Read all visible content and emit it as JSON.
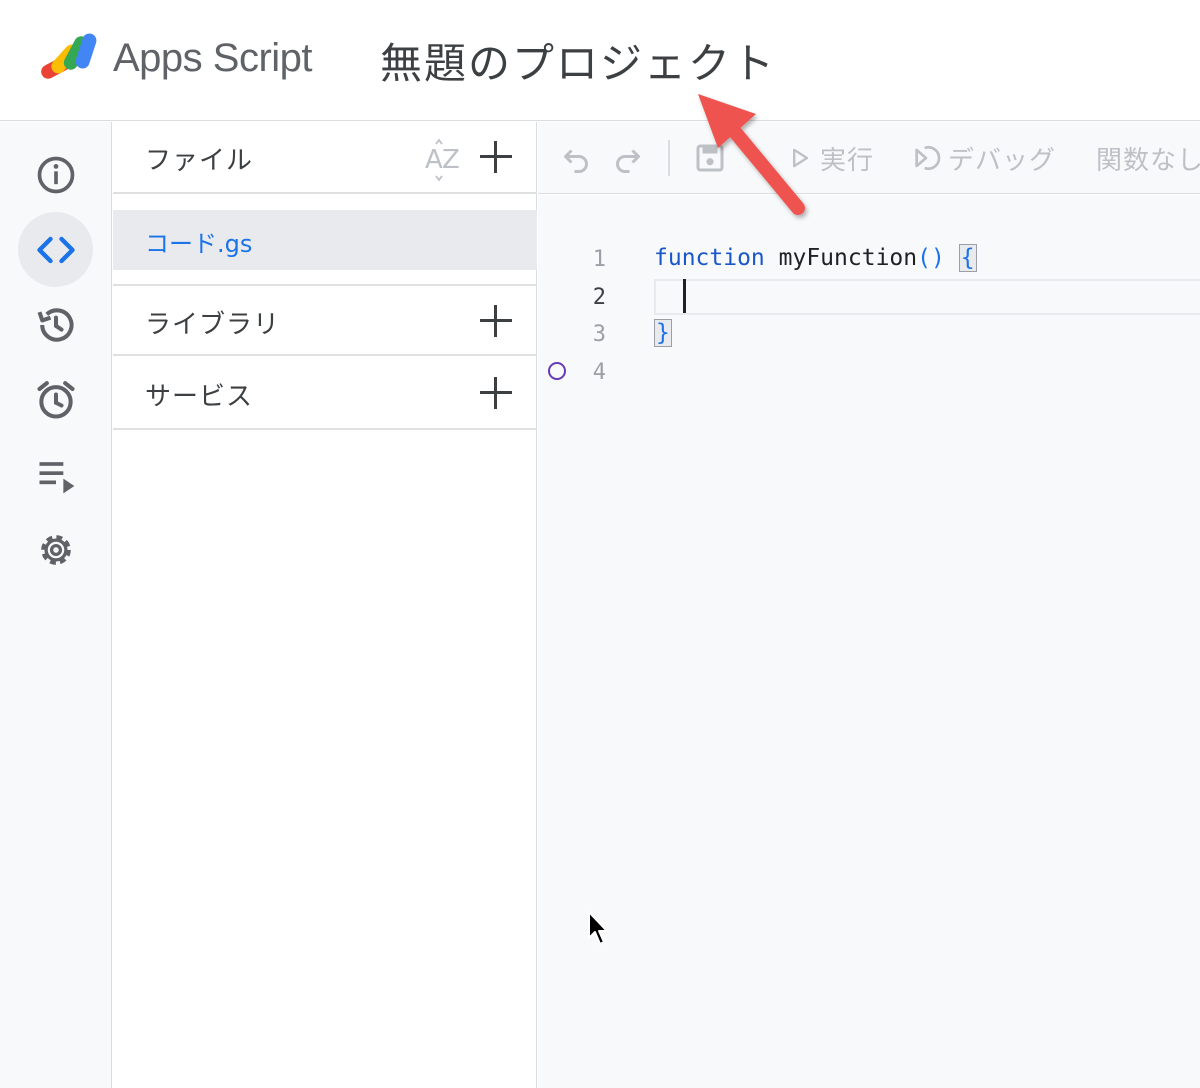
{
  "header": {
    "app_name": "Apps Script",
    "project_title": "無題のプロジェクト",
    "logo": "apps-script-logo"
  },
  "rail": {
    "items": [
      {
        "name": "overview",
        "icon": "info-icon"
      },
      {
        "name": "editor",
        "icon": "code-icon",
        "active": true
      },
      {
        "name": "executions",
        "icon": "history-icon"
      },
      {
        "name": "triggers",
        "icon": "alarm-icon"
      },
      {
        "name": "executions-list",
        "icon": "playlist-play-icon"
      },
      {
        "name": "settings",
        "icon": "gear-icon"
      }
    ]
  },
  "files": {
    "header": "ファイル",
    "items": [
      {
        "label": "コード.gs",
        "selected": true
      }
    ],
    "libraries_label": "ライブラリ",
    "services_label": "サービス"
  },
  "toolbar": {
    "run_label": "実行",
    "debug_label": "デバッグ",
    "function_select": "関数なし"
  },
  "editor": {
    "line_numbers": [
      "1",
      "2",
      "3",
      "4"
    ],
    "code": {
      "keyword": "function",
      "func_name": "myFunction",
      "parens": "()",
      "open_brace": "{",
      "close_brace": "}"
    }
  },
  "colors": {
    "accent": "#1a73e8",
    "keyword": "#1a57c8",
    "annotation_arrow": "#ef5350",
    "breakpoint": "#673ab7"
  }
}
